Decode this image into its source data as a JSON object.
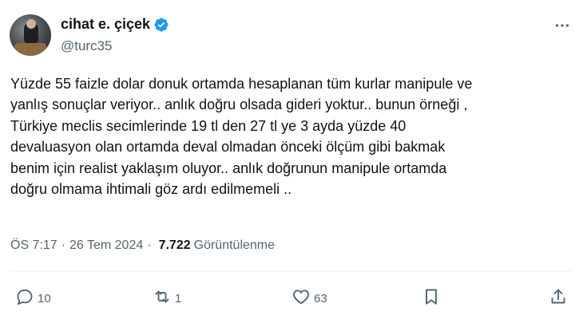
{
  "author": {
    "display_name": "cihat e. çiçek",
    "handle": "@turc35",
    "verified": true
  },
  "tweet": {
    "text": "Yüzde 55 faizle dolar donuk ortamda hesaplanan tüm kurlar manipule ve\nyanlış sonuçlar veriyor.. anlık doğru olsada gideri yoktur.. bunun örneği ,\nTürkiye meclis secimlerinde 19 tl den 27 tl ye 3 ayda yüzde 40\ndevaluasyon olan ortamda deval olmadan önceki ölçüm gibi bakmak\nbenim için realist yaklaşım oluyor.. anlık doğrunun manipule ortamda\ndoğru olmama ihtimali göz ardı edilmemeli .."
  },
  "meta": {
    "time": "ÖS 7:17",
    "separator": "·",
    "date": "26 Tem 2024",
    "views_count": "7.722",
    "views_label": "Görüntülenme"
  },
  "actions": {
    "reply_count": "10",
    "retweet_count": "1",
    "like_count": "63"
  },
  "colors": {
    "text": "#0f1419",
    "secondary": "#536471",
    "verified": "#1d9bf0",
    "divider": "#eff3f4"
  },
  "icons": [
    "more-icon",
    "verified-badge-icon",
    "reply-icon",
    "retweet-icon",
    "like-icon",
    "bookmark-icon",
    "share-icon"
  ]
}
